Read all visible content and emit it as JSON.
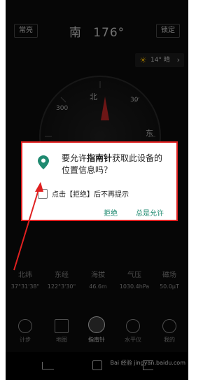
{
  "topbar": {
    "left_button": "常亮",
    "title_direction": "南",
    "title_degree": "176°",
    "right_button": "锁定"
  },
  "weather": {
    "temp": "14° 晴"
  },
  "dial": {
    "north": "北",
    "east": "东",
    "tick_30": "30",
    "tick_300": "300"
  },
  "dialog": {
    "message_prefix": "要允许",
    "app_name": "指南针",
    "message_suffix": "获取此设备的位置信息吗？",
    "checkbox_label": "点击【拒绝】后不再提示",
    "deny_label": "拒绝",
    "allow_label": "总是允许"
  },
  "stats": [
    {
      "label": "北纬",
      "value": "37°31'38\""
    },
    {
      "label": "东经",
      "value": "122°3'30\""
    },
    {
      "label": "海拔",
      "value": "46.6m"
    },
    {
      "label": "气压",
      "value": "1030.4hPa"
    },
    {
      "label": "磁场",
      "value": "50.0μT"
    }
  ],
  "nav": [
    {
      "label": "计步"
    },
    {
      "label": "地图"
    },
    {
      "label": "指南针"
    },
    {
      "label": "水平仪"
    },
    {
      "label": "我的"
    }
  ],
  "watermark": "Bai 经验 jingyan.baidu.com",
  "colors": {
    "accent": "#1f8a70",
    "highlight_red": "#e02020"
  }
}
